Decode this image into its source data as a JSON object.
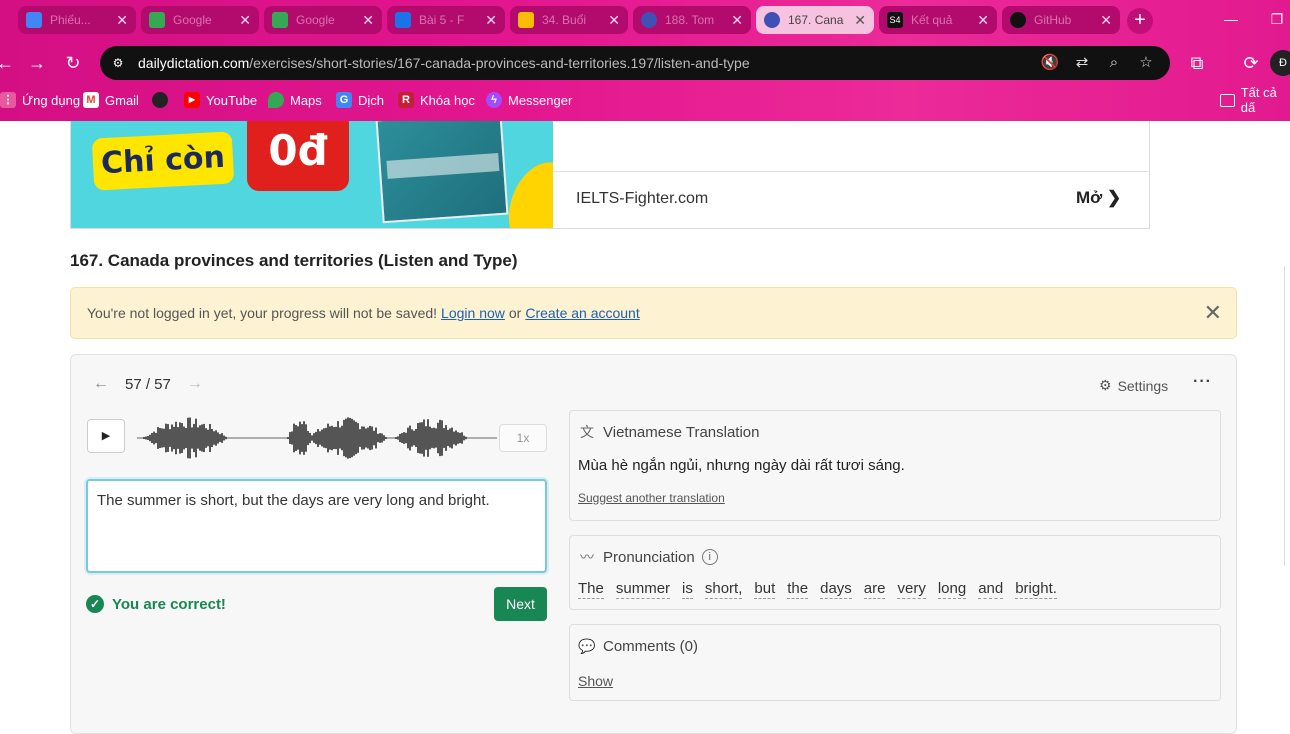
{
  "browser": {
    "tabs": [
      {
        "title": "Phiếu...",
        "color": "#4285f4",
        "active": false
      },
      {
        "title": "Google",
        "color": "#34a853",
        "active": false
      },
      {
        "title": "Google",
        "color": "#34a853",
        "active": false
      },
      {
        "title": "Bài 5 - F",
        "color": "#1a73e8",
        "active": false
      },
      {
        "title": "34. Buổi",
        "color": "#fbbc04",
        "active": false
      },
      {
        "title": "188. Tom",
        "color": "#3f51b5",
        "active": false
      },
      {
        "title": "167. Cana",
        "color": "#3f51b5",
        "active": true
      },
      {
        "title": "Kết quả",
        "color": "#111111",
        "active": false
      },
      {
        "title": "GitHub",
        "color": "#111111",
        "active": false
      }
    ],
    "url_domain": "dailydictation.com",
    "url_path": "/exercises/short-stories/167-canada-provinces-and-territories.197/listen-and-type",
    "bookmarks": [
      {
        "label": "Ứng dụng"
      },
      {
        "label": "Gmail"
      },
      {
        "label": ""
      },
      {
        "label": "YouTube"
      },
      {
        "label": "Maps"
      },
      {
        "label": "Dịch"
      },
      {
        "label": "Khóa học"
      },
      {
        "label": "Messenger"
      }
    ],
    "all_bookmarks": "Tất cả dấ"
  },
  "ad": {
    "badge_text": "Chỉ còn",
    "price": "0đ",
    "site": "IELTS-Fighter.com",
    "open_label": "Mở"
  },
  "exercise": {
    "title": "167. Canada provinces and territories (Listen and Type)",
    "alert_text": "You're not logged in yet, your progress will not be saved!",
    "login_link": "Login now",
    "or_text": "or",
    "create_link": "Create an account",
    "counter": "57 / 57",
    "settings_label": "Settings",
    "speed": "1x",
    "answer": "The summer is short, but the days are very long and bright.",
    "status": "You are correct!",
    "next_label": "Next"
  },
  "translation": {
    "heading": "Vietnamese Translation",
    "text": "Mùa hè ngắn ngủi, nhưng ngày dài rất tươi sáng.",
    "suggest": "Suggest another translation"
  },
  "pronunciation": {
    "heading": "Pronunciation",
    "words": [
      "The",
      "summer",
      "is",
      "short,",
      "but",
      "the",
      "days",
      "are",
      "very",
      "long",
      "and",
      "bright."
    ]
  },
  "comments": {
    "heading": "Comments (0)",
    "show": "Show"
  }
}
